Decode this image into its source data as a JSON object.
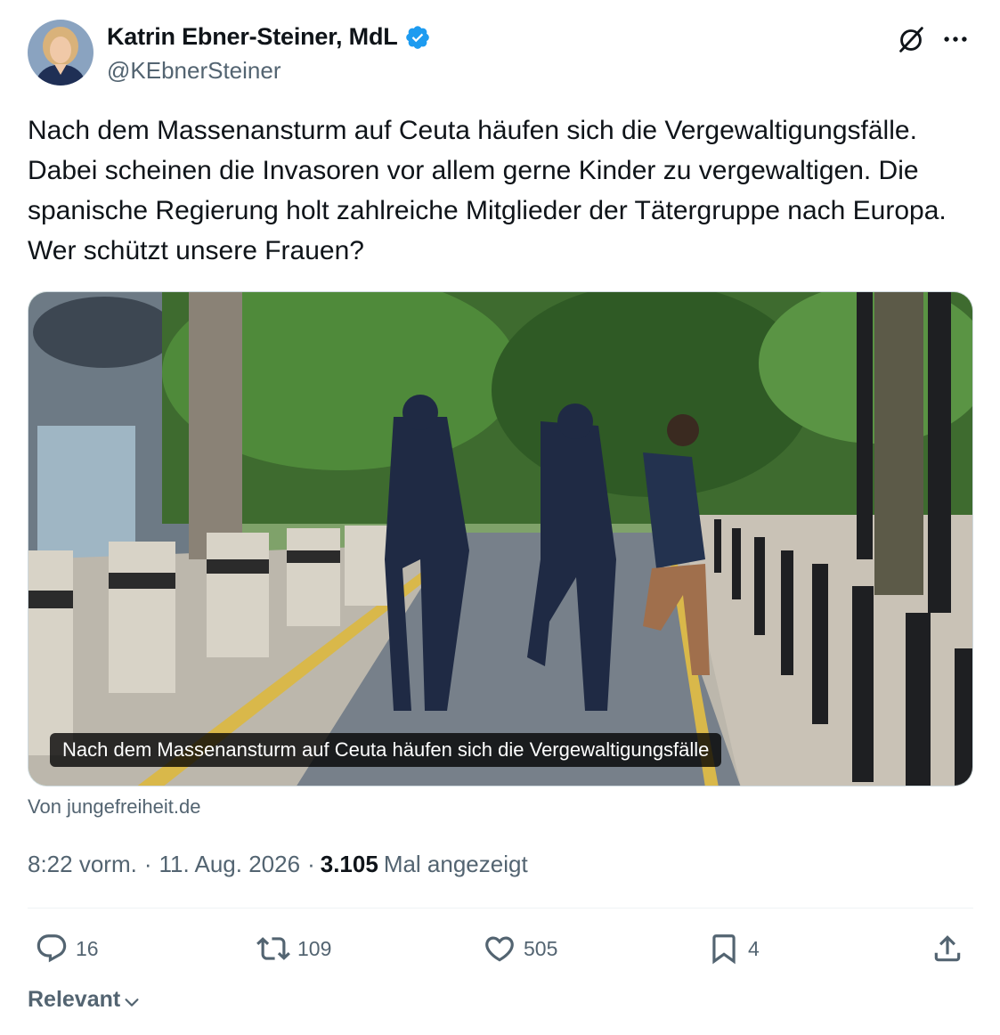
{
  "author": {
    "display_name": "Katrin Ebner-Steiner, MdL",
    "handle": "@KEbnerSteiner",
    "verified": true
  },
  "tweet": {
    "text": "Nach dem Massenansturm auf Ceuta häufen sich die Vergewaltigungsfälle. Dabei scheinen die Invasoren vor allem gerne Kinder zu vergewaltigen. Die spanische Regierung holt zahlreiche Mitglieder der Tätergruppe nach Europa. Wer schützt unsere Frauen?"
  },
  "link_card": {
    "caption": "Nach dem Massenansturm auf Ceuta häufen sich die Vergewaltigungsfälle",
    "source": "Von jungefreiheit.de"
  },
  "meta": {
    "time": "8:22 vorm.",
    "separator": "·",
    "date": "11. Aug. 2026",
    "views_count": "3.105",
    "views_label": "Mal angezeigt"
  },
  "actions": {
    "replies": "16",
    "reposts": "109",
    "likes": "505",
    "bookmarks": "4"
  },
  "sort": {
    "label": "Relevant"
  },
  "colors": {
    "text_primary": "#0f1419",
    "text_secondary": "#536471",
    "verified_blue": "#1d9bf0",
    "divider": "#eff3f4"
  },
  "icons": [
    "grok-icon",
    "more-icon",
    "verified-badge-icon",
    "reply-icon",
    "repost-icon",
    "like-icon",
    "bookmark-icon",
    "share-icon",
    "chevron-down-icon"
  ]
}
